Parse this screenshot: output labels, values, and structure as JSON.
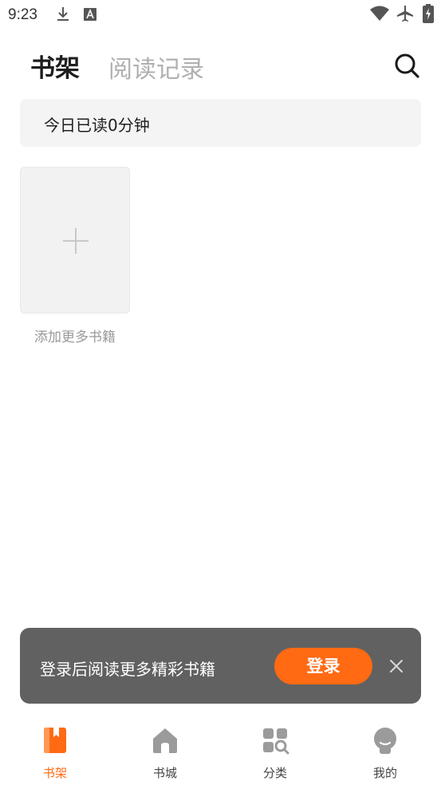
{
  "status_bar": {
    "time": "9:23",
    "icons": [
      "download-icon",
      "font-icon",
      "wifi-icon",
      "airplane-icon",
      "battery-charging-icon"
    ]
  },
  "header": {
    "tabs": [
      {
        "label": "书架",
        "active": true
      },
      {
        "label": "阅读记录",
        "active": false
      }
    ],
    "search_icon": "search-icon"
  },
  "reading_banner": {
    "text": "今日已读0分钟"
  },
  "add_book": {
    "label": "添加更多书籍",
    "icon": "plus-icon"
  },
  "login_toast": {
    "message": "登录后阅读更多精彩书籍",
    "button_label": "登录",
    "close_icon": "close-icon"
  },
  "bottom_nav": {
    "items": [
      {
        "label": "书架",
        "icon": "bookshelf-icon",
        "active": true
      },
      {
        "label": "书城",
        "icon": "home-icon",
        "active": false
      },
      {
        "label": "分类",
        "icon": "category-icon",
        "active": false
      },
      {
        "label": "我的",
        "icon": "profile-icon",
        "active": false
      }
    ]
  },
  "colors": {
    "accent": "#ff6a13",
    "toast_background": "#616161",
    "inactive_tab": "#b0b0b0",
    "nav_icon": "#9b9b9b"
  }
}
